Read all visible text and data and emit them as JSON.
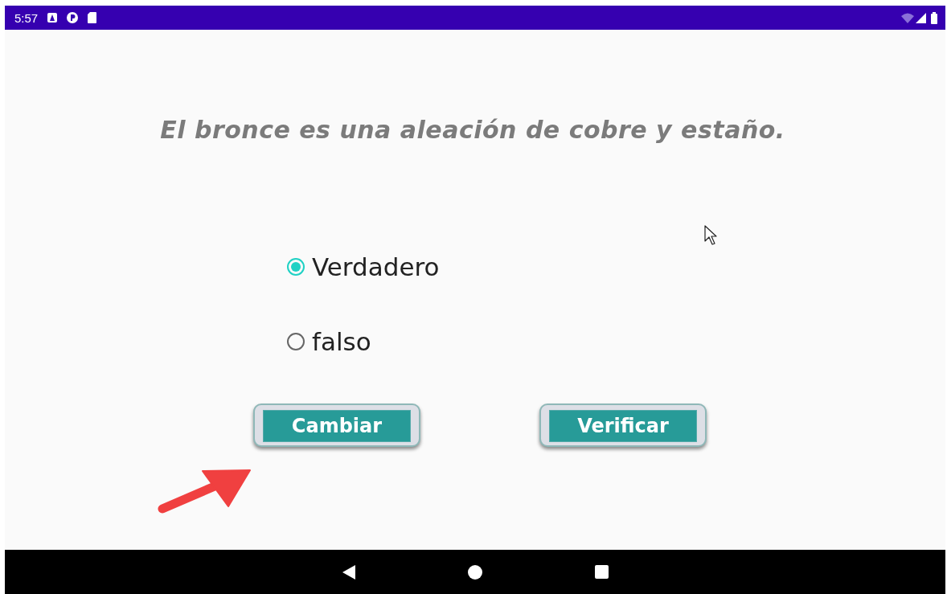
{
  "status_bar": {
    "time": "5:57"
  },
  "question": "El bronce es una aleación de cobre y estaño.",
  "options": [
    {
      "label": "Verdadero",
      "selected": true
    },
    {
      "label": "falso",
      "selected": false
    }
  ],
  "buttons": [
    {
      "label": "Cambiar"
    },
    {
      "label": "Verificar"
    }
  ]
}
